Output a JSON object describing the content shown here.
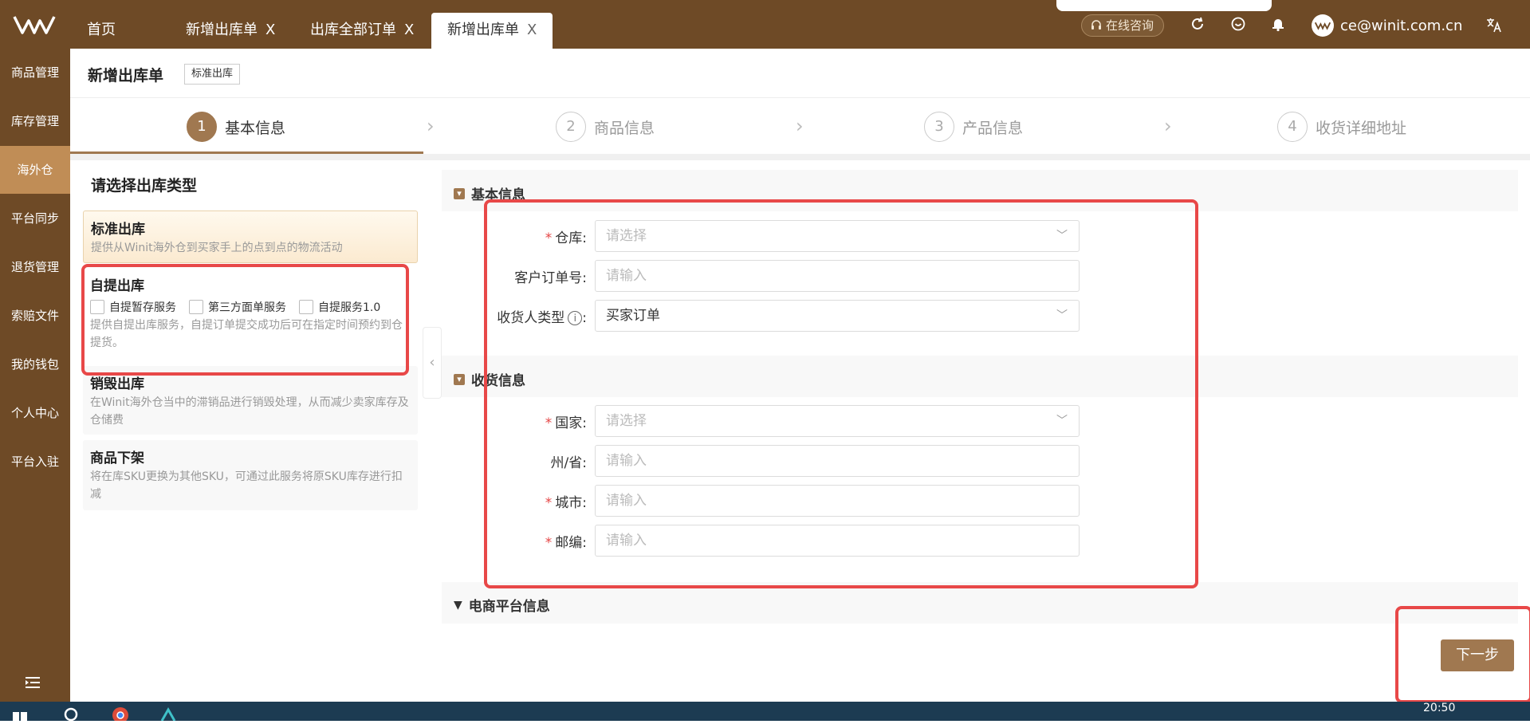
{
  "tabs": [
    {
      "label": "首页",
      "closable": false
    },
    {
      "label": "新增出库单",
      "closable": true
    },
    {
      "label": "出库全部订单",
      "closable": true
    },
    {
      "label": "新增出库单",
      "closable": true,
      "active": true
    }
  ],
  "tab_close_glyph": "X",
  "topbar": {
    "consult_label": "在线咨询",
    "user_email": "ce@winit.com.cn",
    "icons": [
      "refresh-icon",
      "message-icon",
      "bell-icon",
      "translate-icon"
    ]
  },
  "sidebar": {
    "items": [
      {
        "label": "商品管理"
      },
      {
        "label": "库存管理"
      },
      {
        "label": "海外仓",
        "active": true
      },
      {
        "label": "平台同步"
      },
      {
        "label": "退货管理"
      },
      {
        "label": "索赔文件"
      },
      {
        "label": "我的钱包"
      },
      {
        "label": "个人中心"
      },
      {
        "label": "平台入驻"
      }
    ]
  },
  "page": {
    "title": "新增出库单",
    "tag": "标准出库"
  },
  "steps": [
    {
      "num": "1",
      "label": "基本信息",
      "active": true
    },
    {
      "num": "2",
      "label": "商品信息"
    },
    {
      "num": "3",
      "label": "产品信息"
    },
    {
      "num": "4",
      "label": "收货详细地址"
    }
  ],
  "outbound_types": {
    "title": "请选择出库类型",
    "cards": [
      {
        "title": "标准出库",
        "desc": "提供从Winit海外仓到买家手上的点到点的物流活动",
        "selected": true
      },
      {
        "title": "自提出库",
        "options": [
          "自提暂存服务",
          "第三方面单服务",
          "自提服务1.0"
        ],
        "desc": "提供自提出库服务，自提订单提交成功后可在指定时间预约到仓提货。"
      },
      {
        "title": "销毁出库",
        "desc": "在Winit海外仓当中的滞销品进行销毁处理，从而减少卖家库存及仓储费"
      },
      {
        "title": "商品下架",
        "desc": "将在库SKU更换为其他SKU，可通过此服务将原SKU库存进行扣减"
      }
    ]
  },
  "basic_info": {
    "section_title": "基本信息",
    "warehouse": {
      "label": "仓库:",
      "placeholder": "请选择",
      "required": true
    },
    "customer_order": {
      "label": "客户订单号:",
      "placeholder": "请输入"
    },
    "consignee_type": {
      "label": "收货人类型",
      "suffix": ":",
      "value": "买家订单"
    }
  },
  "receive_info": {
    "section_title": "收货信息",
    "country": {
      "label": "国家:",
      "placeholder": "请选择",
      "required": true
    },
    "state": {
      "label": "州/省:",
      "placeholder": "请输入"
    },
    "city": {
      "label": "城市:",
      "placeholder": "请输入",
      "required": true
    },
    "zip": {
      "label": "邮编:",
      "placeholder": "请输入",
      "required": true
    }
  },
  "ecommerce": {
    "section_title": "电商平台信息"
  },
  "next_button": "下一步",
  "taskbar": {
    "time": "20:50"
  },
  "colors": {
    "brand": "#6e4a26",
    "accent": "#a07850",
    "annotation": "#e84848",
    "active_sidebar": "#c08d56"
  }
}
